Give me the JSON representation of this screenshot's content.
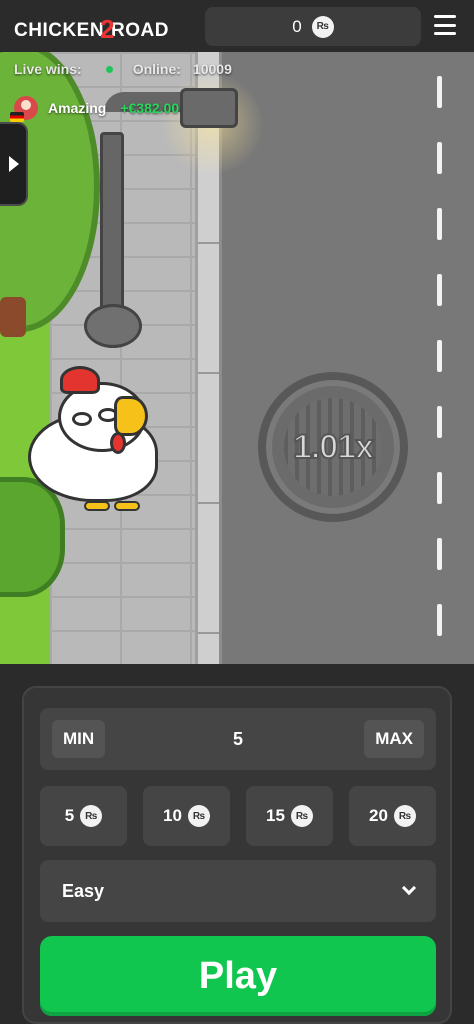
{
  "header": {
    "logo_text_left": "CHICKEN",
    "logo_text_num": "2",
    "logo_text_right": "ROAD",
    "balance_value": "0",
    "currency_symbol": "₨"
  },
  "live": {
    "live_wins_label": "Live wins:",
    "online_label": "Online:",
    "online_count": "10009",
    "winner_name": "Amazing",
    "winner_amount": "+€382.00"
  },
  "game": {
    "multiplier": "1.01x"
  },
  "controls": {
    "min_label": "MIN",
    "max_label": "MAX",
    "bet_value": "5",
    "chips": [
      "5",
      "10",
      "15",
      "20"
    ],
    "difficulty": "Easy",
    "play_label": "Play"
  },
  "colors": {
    "play": "#11c64f",
    "win_amount": "#27d85a",
    "online_dot": "#1fc45a",
    "background": "#2b2b2b"
  }
}
